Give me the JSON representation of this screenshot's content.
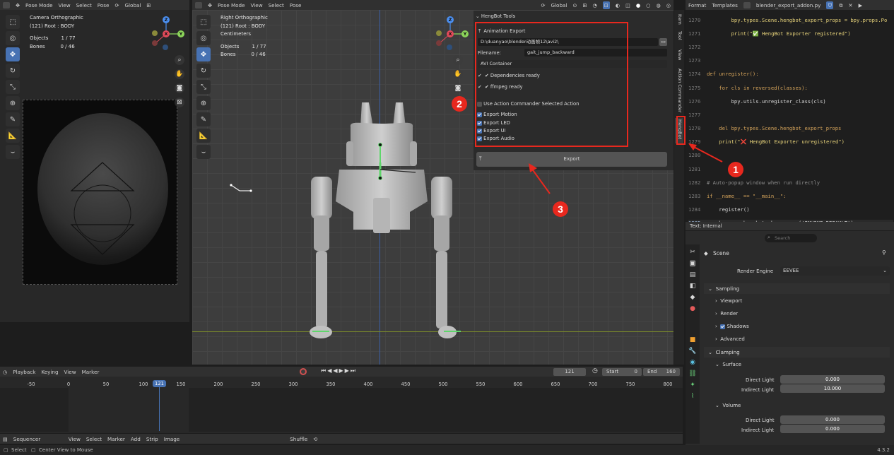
{
  "left_view": {
    "mode": "Pose Mode",
    "menus": [
      "View",
      "Select",
      "Pose"
    ],
    "orientation": "Global",
    "overlay": [
      "Camera Orthographic",
      "(121) Root : BODY"
    ],
    "stats": [
      [
        "Objects",
        "1 / 77"
      ],
      [
        "Bones",
        "0 / 46"
      ]
    ]
  },
  "main_view": {
    "mode": "Pose Mode",
    "menus": [
      "View",
      "Select",
      "Pose"
    ],
    "orientation": "Global",
    "overlay": [
      "Right Orthographic",
      "(121) Root : BODY",
      "Centimeters"
    ],
    "stats": [
      [
        "Objects",
        "1 / 77"
      ],
      [
        "Bones",
        "0 / 46"
      ]
    ]
  },
  "gizmo": {
    "z": "Z",
    "x": "X",
    "y": "Y"
  },
  "hengbot": {
    "panel_title": "HengBot Tools",
    "section_title": "Animation Export",
    "path": "D:\\duanyao\\blender动画帧12\\avi2\\",
    "filename_label": "Filename:",
    "filename_value": "gait_jump_backward",
    "container": "AVI Container",
    "dep_ready": "✔ Dependencies ready",
    "ffmpeg_ready": "✔ ffmpeg ready",
    "use_action": "Use Action Commander Selected Action",
    "checks": [
      "Export Motion",
      "Export LED",
      "Export UI",
      "Export Audio"
    ],
    "export_button": "Export"
  },
  "side_tabs": [
    "Item",
    "Tool",
    "View",
    "Action Commander",
    "HengBot"
  ],
  "text_editor": {
    "menus": [
      "Format",
      "Templates"
    ],
    "filename": "blender_export_addon.py",
    "status": "Text: Internal",
    "lines": [
      [
        "1270",
        "        bpy.types.Scene.hengbot_export_props = bpy.props.Po"
      ],
      [
        "1271",
        "        print(\"✅ HengBot Exporter registered\")"
      ],
      [
        "1272",
        ""
      ],
      [
        "1273",
        ""
      ],
      [
        "1274",
        "def unregister():"
      ],
      [
        "1275",
        "    for cls in reversed(classes):"
      ],
      [
        "1276",
        "        bpy.utils.unregister_class(cls)"
      ],
      [
        "1277",
        ""
      ],
      [
        "1278",
        "    del bpy.types.Scene.hengbot_export_props"
      ],
      [
        "1279",
        "    print(\"❌ HengBot Exporter unregistered\")"
      ],
      [
        "1280",
        ""
      ],
      [
        "1281",
        ""
      ],
      [
        "1282",
        "# Auto-popup window when run directly"
      ],
      [
        "1283",
        "if __name__ == \"__main__\":"
      ],
      [
        "1284",
        "    register()"
      ],
      [
        "1285",
        "    bpy.ops.hengbot.show_popup('INVOKE_DEFAULT')"
      ]
    ]
  },
  "properties": {
    "search_placeholder": "Search",
    "scene": "Scene",
    "render_engine_label": "Render Engine",
    "render_engine": "EEVEE",
    "sampling": "Sampling",
    "viewport": "Viewport",
    "render": "Render",
    "shadows": "Shadows",
    "advanced": "Advanced",
    "clamping": "Clamping",
    "surface": "Surface",
    "direct_light": "Direct Light",
    "indirect_light": "Indirect Light",
    "surface_direct": "0.000",
    "surface_indirect": "10.000",
    "volume": "Volume",
    "volume_direct": "0.000",
    "volume_indirect": "0.000"
  },
  "timeline": {
    "menus": [
      "Playback",
      "Keying",
      "View",
      "Marker"
    ],
    "current_frame": "121",
    "start_label": "Start",
    "start": "0",
    "end_label": "End",
    "end": "160",
    "ticks": [
      "-50",
      "0",
      "50",
      "100",
      "121",
      "150",
      "200",
      "250",
      "300",
      "350",
      "400",
      "450",
      "500",
      "550",
      "600",
      "650",
      "700",
      "750",
      "800"
    ]
  },
  "sequencer": {
    "label": "Sequencer",
    "menus": [
      "View",
      "Select",
      "Marker",
      "Add",
      "Strip",
      "Image"
    ],
    "shuffle": "Shuffle"
  },
  "status": {
    "select": "Select",
    "center": "Center View to Mouse",
    "version": "4.3.2"
  },
  "annotations": {
    "b1": "1",
    "b2": "2",
    "b3": "3"
  },
  "colors": {
    "accent": "#4772b3",
    "annotation": "#e8281e",
    "bone": "#5fd66b"
  }
}
